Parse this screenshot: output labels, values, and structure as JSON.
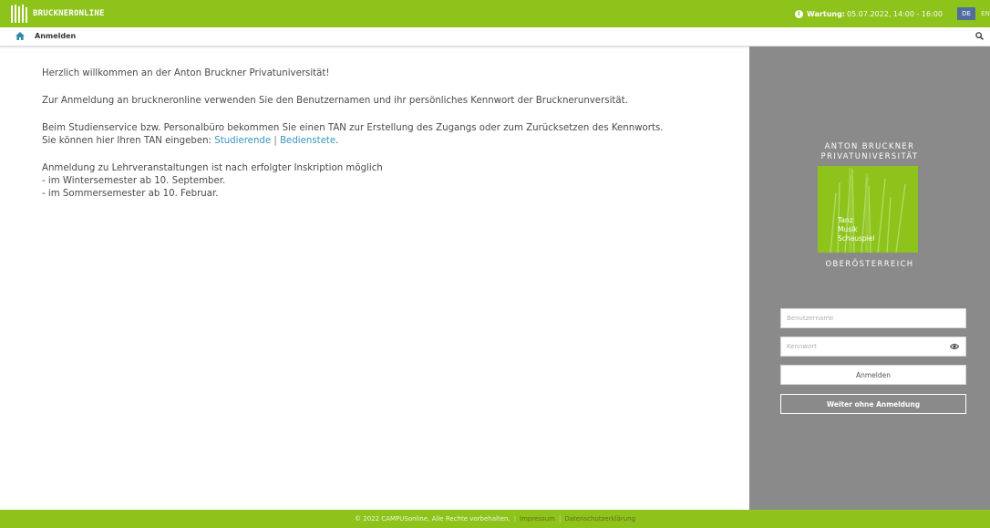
{
  "header": {
    "logo_text": "BRUCKNERONLINE",
    "maintenance_label": "Wartung:",
    "maintenance_value": "05.07.2022, 14:00 - 16:00",
    "lang_de": "DE",
    "lang_en": "EN"
  },
  "subheader": {
    "title": "Anmelden"
  },
  "main": {
    "welcome": "Herzlich willkommen an der Anton Bruckner Privatuniversität!",
    "login_info": "Zur Anmeldung an bruckneronline verwenden Sie den Benutzernamen und ihr persönliches Kennwort der Brucknerunversität.",
    "tan_line1": "Beim Studienservice bzw. Personalbüro bekommen Sie einen TAN zur Erstellung des Zugangs oder zum Zurücksetzen des Kennworts.",
    "tan_line2_prefix": "Sie können hier Ihren TAN eingeben: ",
    "link_students": "Studierende",
    "link_separator": " | ",
    "link_staff": "Bedienstete",
    "link_suffix": ".",
    "courses_line1": "Anmeldung zu Lehrveranstaltungen ist nach erfolgter Inskription möglich",
    "courses_line2": "- im Wintersemester ab 10. September.",
    "courses_line3": "- im Sommersemester ab 10. Februar."
  },
  "sidebar": {
    "uni_line1": "ANTON BRUCKNER",
    "uni_line2": "PRIVATUNIVERSITÄT",
    "emblem_line1": "Tanz",
    "emblem_line2": "Musik",
    "emblem_line3": "Schauspiel",
    "uni_region": "OBERÖSTERREICH",
    "username_placeholder": "Benutzername",
    "password_placeholder": "Kennwort",
    "login_button": "Anmelden",
    "guest_button": "Weiter ohne Anmeldung"
  },
  "footer": {
    "copyright": "© 2022 CAMPUSonline. Alle Rechte vorbehalten.",
    "separator": "|",
    "impressum": "Impressum",
    "privacy": "Datenschutzerklärung"
  },
  "colors": {
    "brand_green": "#8dc31a",
    "sidebar_grey": "#8a8a8a",
    "link_blue": "#3a93bd",
    "lang_active_bg": "#4f6d9e"
  },
  "icons": [
    "logo-icon",
    "info-icon",
    "home-icon",
    "search-icon",
    "eye-icon"
  ]
}
